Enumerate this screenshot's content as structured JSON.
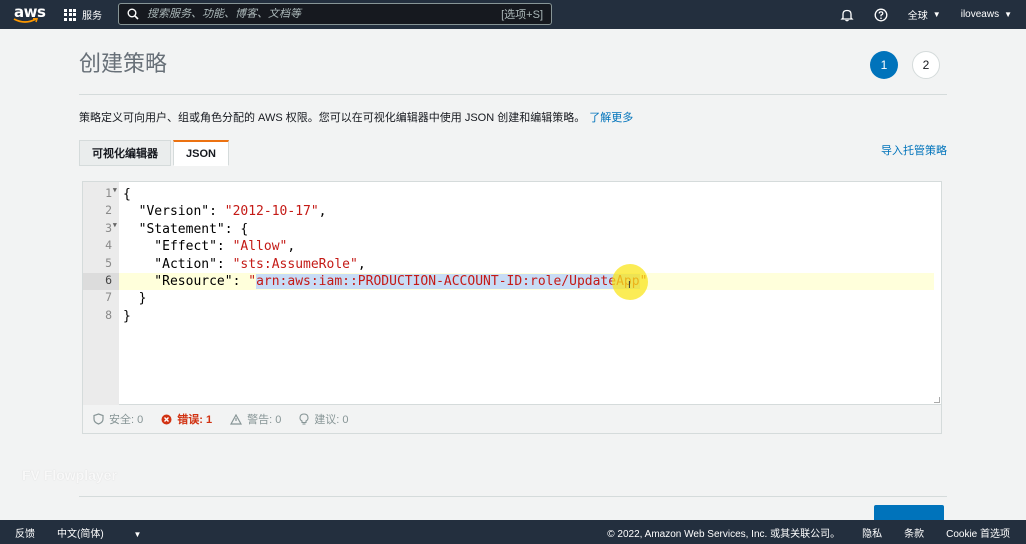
{
  "nav": {
    "logo_text": "aws",
    "services_label": "服务",
    "search_placeholder": "搜索服务、功能、博客、文档等",
    "search_shortcut": "[选项+S]",
    "region_label": "全球",
    "user_label": "iloveaws"
  },
  "page": {
    "title": "创建策略",
    "steps": [
      "1",
      "2"
    ],
    "description": "策略定义可向用户、组或角色分配的 AWS 权限。您可以在可视化编辑器中使用 JSON 创建和编辑策略。",
    "learn_more": "了解更多",
    "tabs": [
      "可视化编辑器",
      "JSON"
    ],
    "import_link": "导入托管策略"
  },
  "editor": {
    "line_numbers": [
      "1",
      "2",
      "3",
      "4",
      "5",
      "6",
      "7",
      "8"
    ],
    "lines": {
      "l1": "{",
      "l2_key": "  \"Version\": ",
      "l2_val": "\"2012-10-17\"",
      "l2_end": ",",
      "l3": "  \"Statement\": {",
      "l4_key": "    \"Effect\": ",
      "l4_val": "\"Allow\"",
      "l4_end": ",",
      "l5_key": "    \"Action\": ",
      "l5_val": "\"sts:AssumeRole\"",
      "l5_end": ",",
      "l6_key": "    \"Resource\": ",
      "l6_q": "\"",
      "l6_sel": "arn:aws:iam::PRODUCTION-ACCOUNT-ID:role/UpdateApp",
      "l6_end": "\"",
      "l7": "  }",
      "l8": "}"
    }
  },
  "status": {
    "security": "安全: 0",
    "errors": "错误: 1",
    "warnings": "警告: 0",
    "suggestions": "建议: 0"
  },
  "watermark": "FV Flowplayer",
  "footer": {
    "feedback": "反馈",
    "language": "中文(简体)",
    "copyright": "© 2022, Amazon Web Services, Inc. 或其关联公司。",
    "privacy": "隐私",
    "terms": "条款",
    "cookie": "Cookie 首选项"
  },
  "colors": {
    "nav_bg": "#232f3e",
    "accent_blue": "#0073bb",
    "tab_accent": "#ec7211",
    "error_red": "#d13212",
    "string_red": "#c41a16"
  }
}
